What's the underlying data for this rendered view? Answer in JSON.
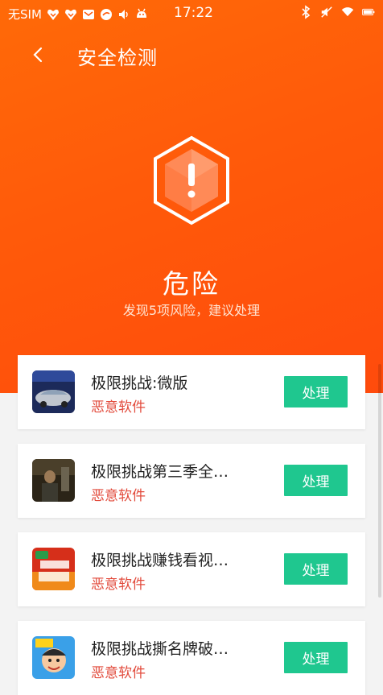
{
  "statusbar": {
    "carrier": "无SIM",
    "time": "17:22",
    "icons_left": [
      "heart-shield-icon",
      "heart-shield-icon",
      "mail-icon",
      "app-badge-icon",
      "volume-icon",
      "android-icon"
    ],
    "icons_right": [
      "bluetooth-icon",
      "mute-icon",
      "wifi-icon",
      "battery-icon"
    ]
  },
  "header": {
    "title": "安全检测"
  },
  "result": {
    "status": "危险",
    "summary": "发现5项风险，建议处理"
  },
  "risks": [
    {
      "name": "极限挑战:微版",
      "label": "恶意软件",
      "action": "处理"
    },
    {
      "name": "极限挑战第三季全…",
      "label": "恶意软件",
      "action": "处理"
    },
    {
      "name": "极限挑战赚钱看视…",
      "label": "恶意软件",
      "action": "处理"
    },
    {
      "name": "极限挑战撕名牌破…",
      "label": "恶意软件",
      "action": "处理"
    }
  ],
  "colors": {
    "accent": "#ff5a0a",
    "action": "#1fc78f",
    "danger_text": "#e24a3b"
  }
}
